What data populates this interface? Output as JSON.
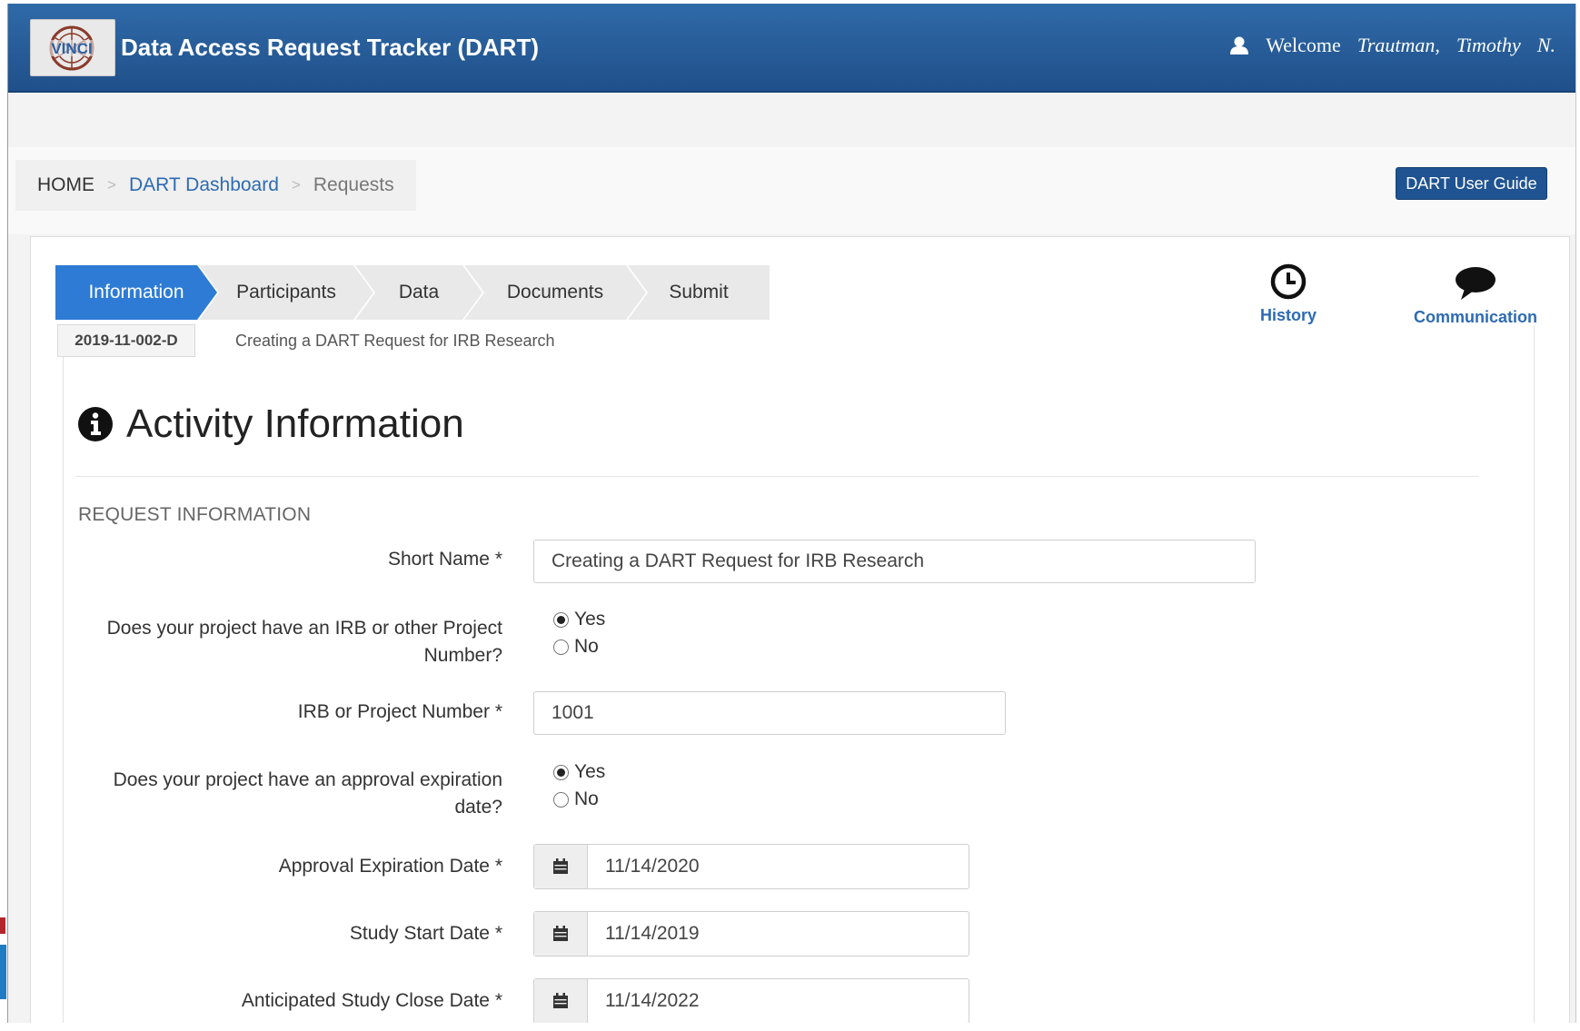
{
  "header": {
    "app_title": "Data Access Request Tracker (DART)",
    "logo_text": "VINCI",
    "welcome_label": "Welcome",
    "user_last": "Trautman,",
    "user_first": "Timothy",
    "user_initial": "N."
  },
  "breadcrumb": {
    "home": "HOME",
    "dashboard": "DART Dashboard",
    "current": "Requests"
  },
  "user_guide_button": "DART User Guide",
  "wizard_steps": [
    {
      "label": "Information",
      "active": true
    },
    {
      "label": "Participants",
      "active": false
    },
    {
      "label": "Data",
      "active": false
    },
    {
      "label": "Documents",
      "active": false
    },
    {
      "label": "Submit",
      "active": false
    }
  ],
  "request": {
    "id": "2019-11-002-D",
    "short_name": "Creating a DART Request for IRB Research"
  },
  "actions": {
    "history": "History",
    "communication": "Communication"
  },
  "page_title": "Activity Information",
  "section_title": "REQUEST INFORMATION",
  "form": {
    "short_name": {
      "label": "Short Name *",
      "value": "Creating a DART Request for IRB Research"
    },
    "has_irb": {
      "label_line1": "Does your project have an IRB or other Project",
      "label_line2": "Number?",
      "yes": "Yes",
      "no": "No",
      "selected": "Yes"
    },
    "irb_number": {
      "label": "IRB or Project Number *",
      "value": "1001"
    },
    "has_expiration": {
      "label_line1": "Does your project have an approval expiration",
      "label_line2": "date?",
      "yes": "Yes",
      "no": "No",
      "selected": "Yes"
    },
    "approval_expiration": {
      "label": "Approval Expiration Date *",
      "value": "11/14/2020"
    },
    "study_start": {
      "label": "Study Start Date *",
      "value": "11/14/2019"
    },
    "study_close": {
      "label": "Anticipated Study Close Date *",
      "value": "11/14/2022"
    }
  },
  "colors": {
    "header_blue": "#2f6aa8",
    "active_step": "#2d7bd4",
    "link_blue": "#2d6bb3",
    "button_blue": "#1f5391"
  }
}
